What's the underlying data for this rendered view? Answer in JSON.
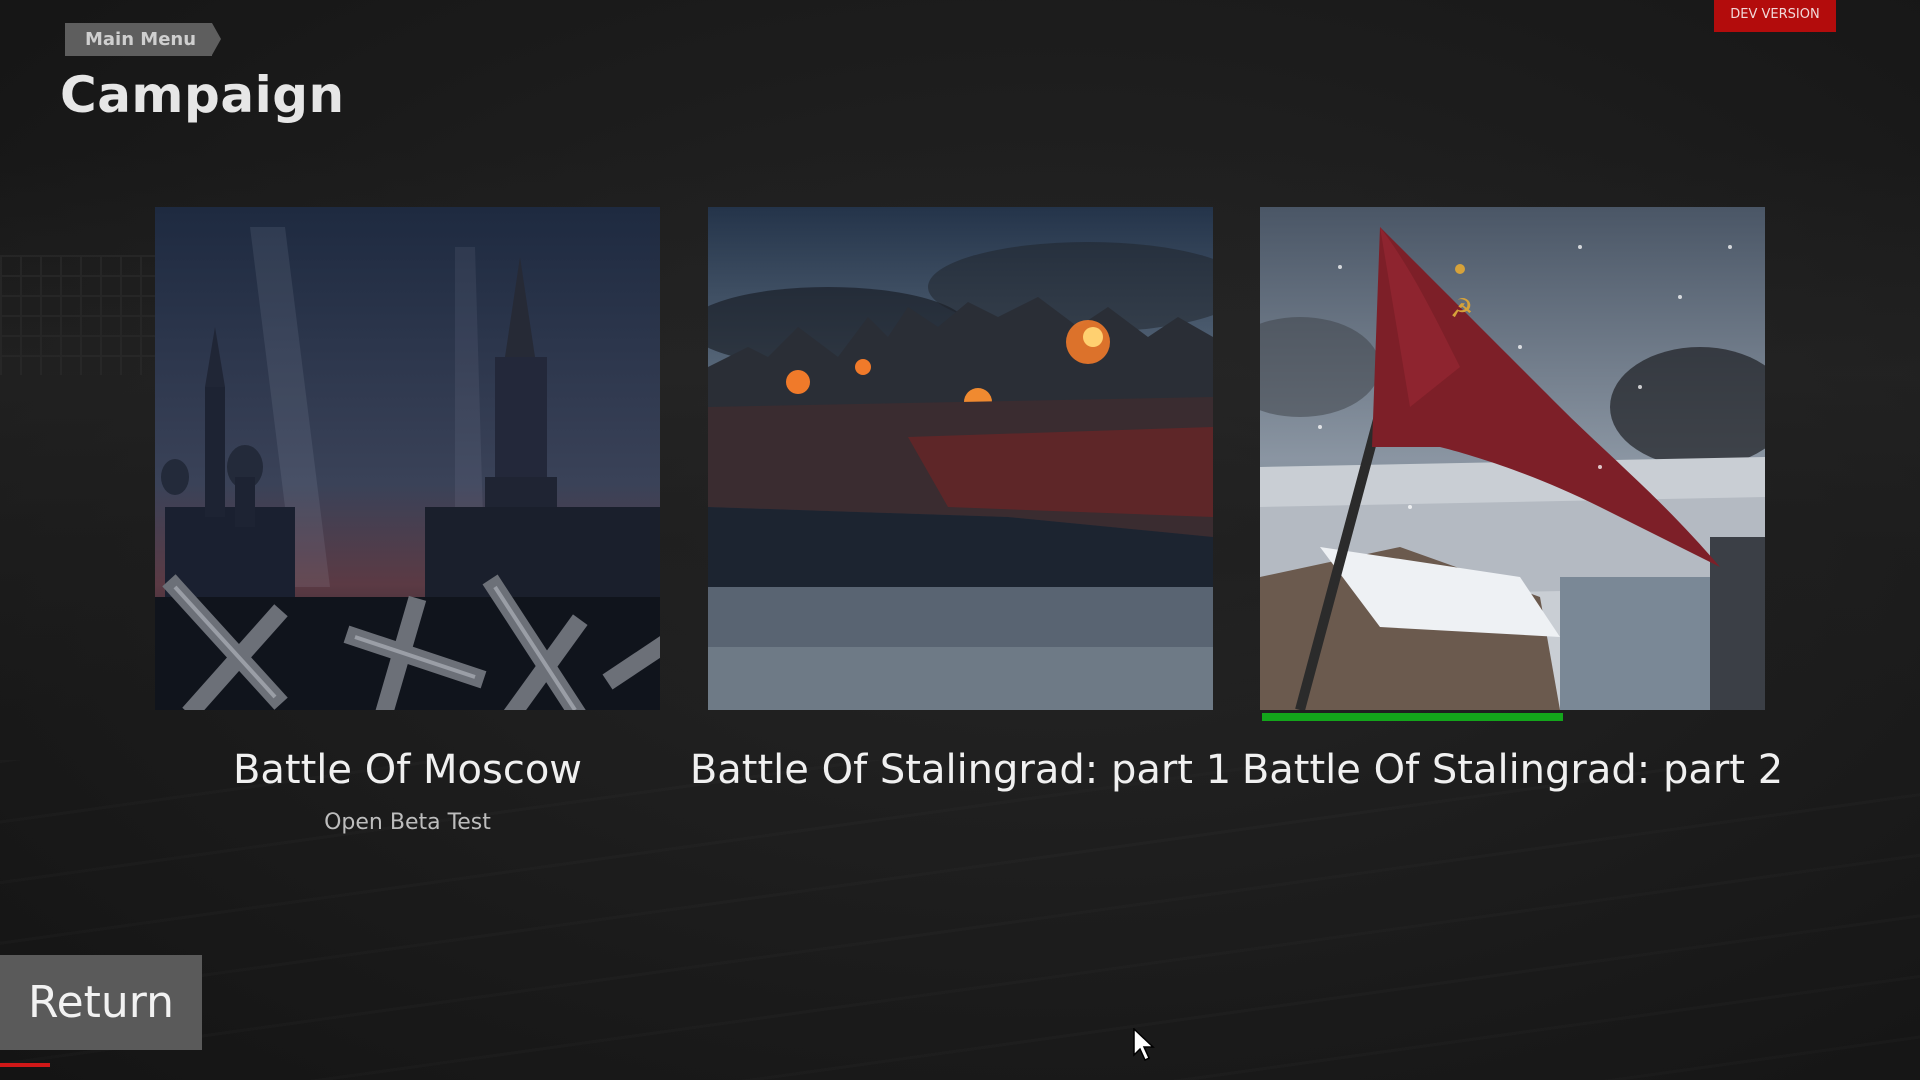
{
  "breadcrumb": {
    "label": "Main Menu"
  },
  "page": {
    "title": "Campaign"
  },
  "badge": {
    "label": "DEV VERSION",
    "color": "#b30c0c"
  },
  "campaigns": [
    {
      "title": "Battle Of Moscow",
      "subtitle": "Open Beta Test",
      "image": "moscow-kremlin-art"
    },
    {
      "title": "Battle Of Stalingrad: part 1",
      "subtitle": "",
      "image": "burning-city-art"
    },
    {
      "title": "Battle Of Stalingrad: part 2",
      "subtitle": "",
      "image": "soviet-flag-art",
      "progress": 0.6
    }
  ],
  "return_button": {
    "label": "Return"
  },
  "colors": {
    "progress": "#13a61b",
    "accent_underline": "#d01818"
  }
}
